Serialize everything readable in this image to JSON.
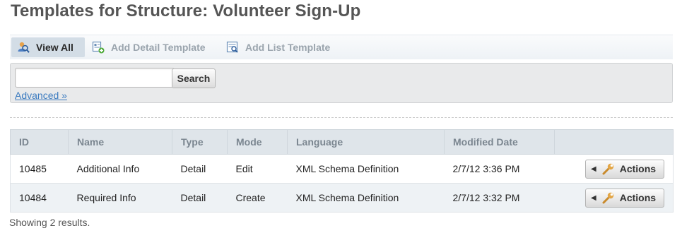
{
  "page": {
    "title": "Templates for Structure: Volunteer Sign-Up"
  },
  "toolbar": {
    "items": [
      {
        "label": "View All",
        "icon": "view-all-icon"
      },
      {
        "label": "Add Detail Template",
        "icon": "add-detail-template-icon"
      },
      {
        "label": "Add List Template",
        "icon": "add-list-template-icon"
      }
    ]
  },
  "search": {
    "value": "",
    "placeholder": "",
    "button_label": "Search",
    "advanced_label": "Advanced »"
  },
  "table": {
    "columns": [
      "ID",
      "Name",
      "Type",
      "Mode",
      "Language",
      "Modified Date",
      ""
    ],
    "rows": [
      {
        "id": "10485",
        "name": "Additional Info",
        "type": "Detail",
        "mode": "Edit",
        "language": "XML Schema Definition",
        "modified": "2/7/12 3:36 PM",
        "action": "Actions"
      },
      {
        "id": "10484",
        "name": "Required Info",
        "type": "Detail",
        "mode": "Create",
        "language": "XML Schema Definition",
        "modified": "2/7/12 3:32 PM",
        "action": "Actions"
      }
    ]
  },
  "footer": {
    "results_text": "Showing 2 results."
  },
  "colors": {
    "link": "#3d7cc0",
    "header_bg": "#dfe5ea",
    "active_tab_bg": "#d3dde6"
  }
}
